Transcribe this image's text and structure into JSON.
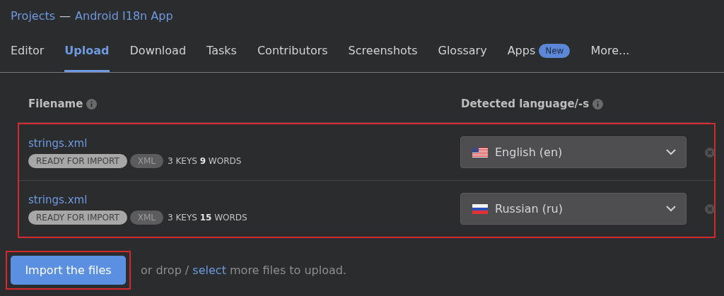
{
  "breadcrumb": {
    "project_link": "Projects",
    "separator": "—",
    "app_link": "Android I18n App"
  },
  "tabs": [
    {
      "label": "Editor",
      "selected": false
    },
    {
      "label": "Upload",
      "selected": true
    },
    {
      "label": "Download",
      "selected": false
    },
    {
      "label": "Tasks",
      "selected": false
    },
    {
      "label": "Contributors",
      "selected": false
    },
    {
      "label": "Screenshots",
      "selected": false
    },
    {
      "label": "Glossary",
      "selected": false
    },
    {
      "label": "Apps",
      "selected": false,
      "badge": "New"
    },
    {
      "label": "More...",
      "selected": false
    }
  ],
  "table": {
    "columns": [
      "Filename",
      "Detected language/-s"
    ],
    "highlighted": true,
    "rows": [
      {
        "filename": "strings.xml",
        "status": "READY FOR IMPORT",
        "format": "XML",
        "stats": "3 KEYS **9** WORDS",
        "language": "English (en)",
        "kind": "us"
      },
      {
        "filename": "strings.xml",
        "status": "READY FOR IMPORT",
        "format": "XML",
        "stats": "3 KEYS **15** WORDS",
        "language": "Russian (ru)",
        "kind": "ru"
      }
    ]
  },
  "footer": {
    "import_button": "Import the files",
    "import_highlighted": true,
    "text_before": "or drop /",
    "select_link": "select",
    "text_after": "more files to upload."
  }
}
